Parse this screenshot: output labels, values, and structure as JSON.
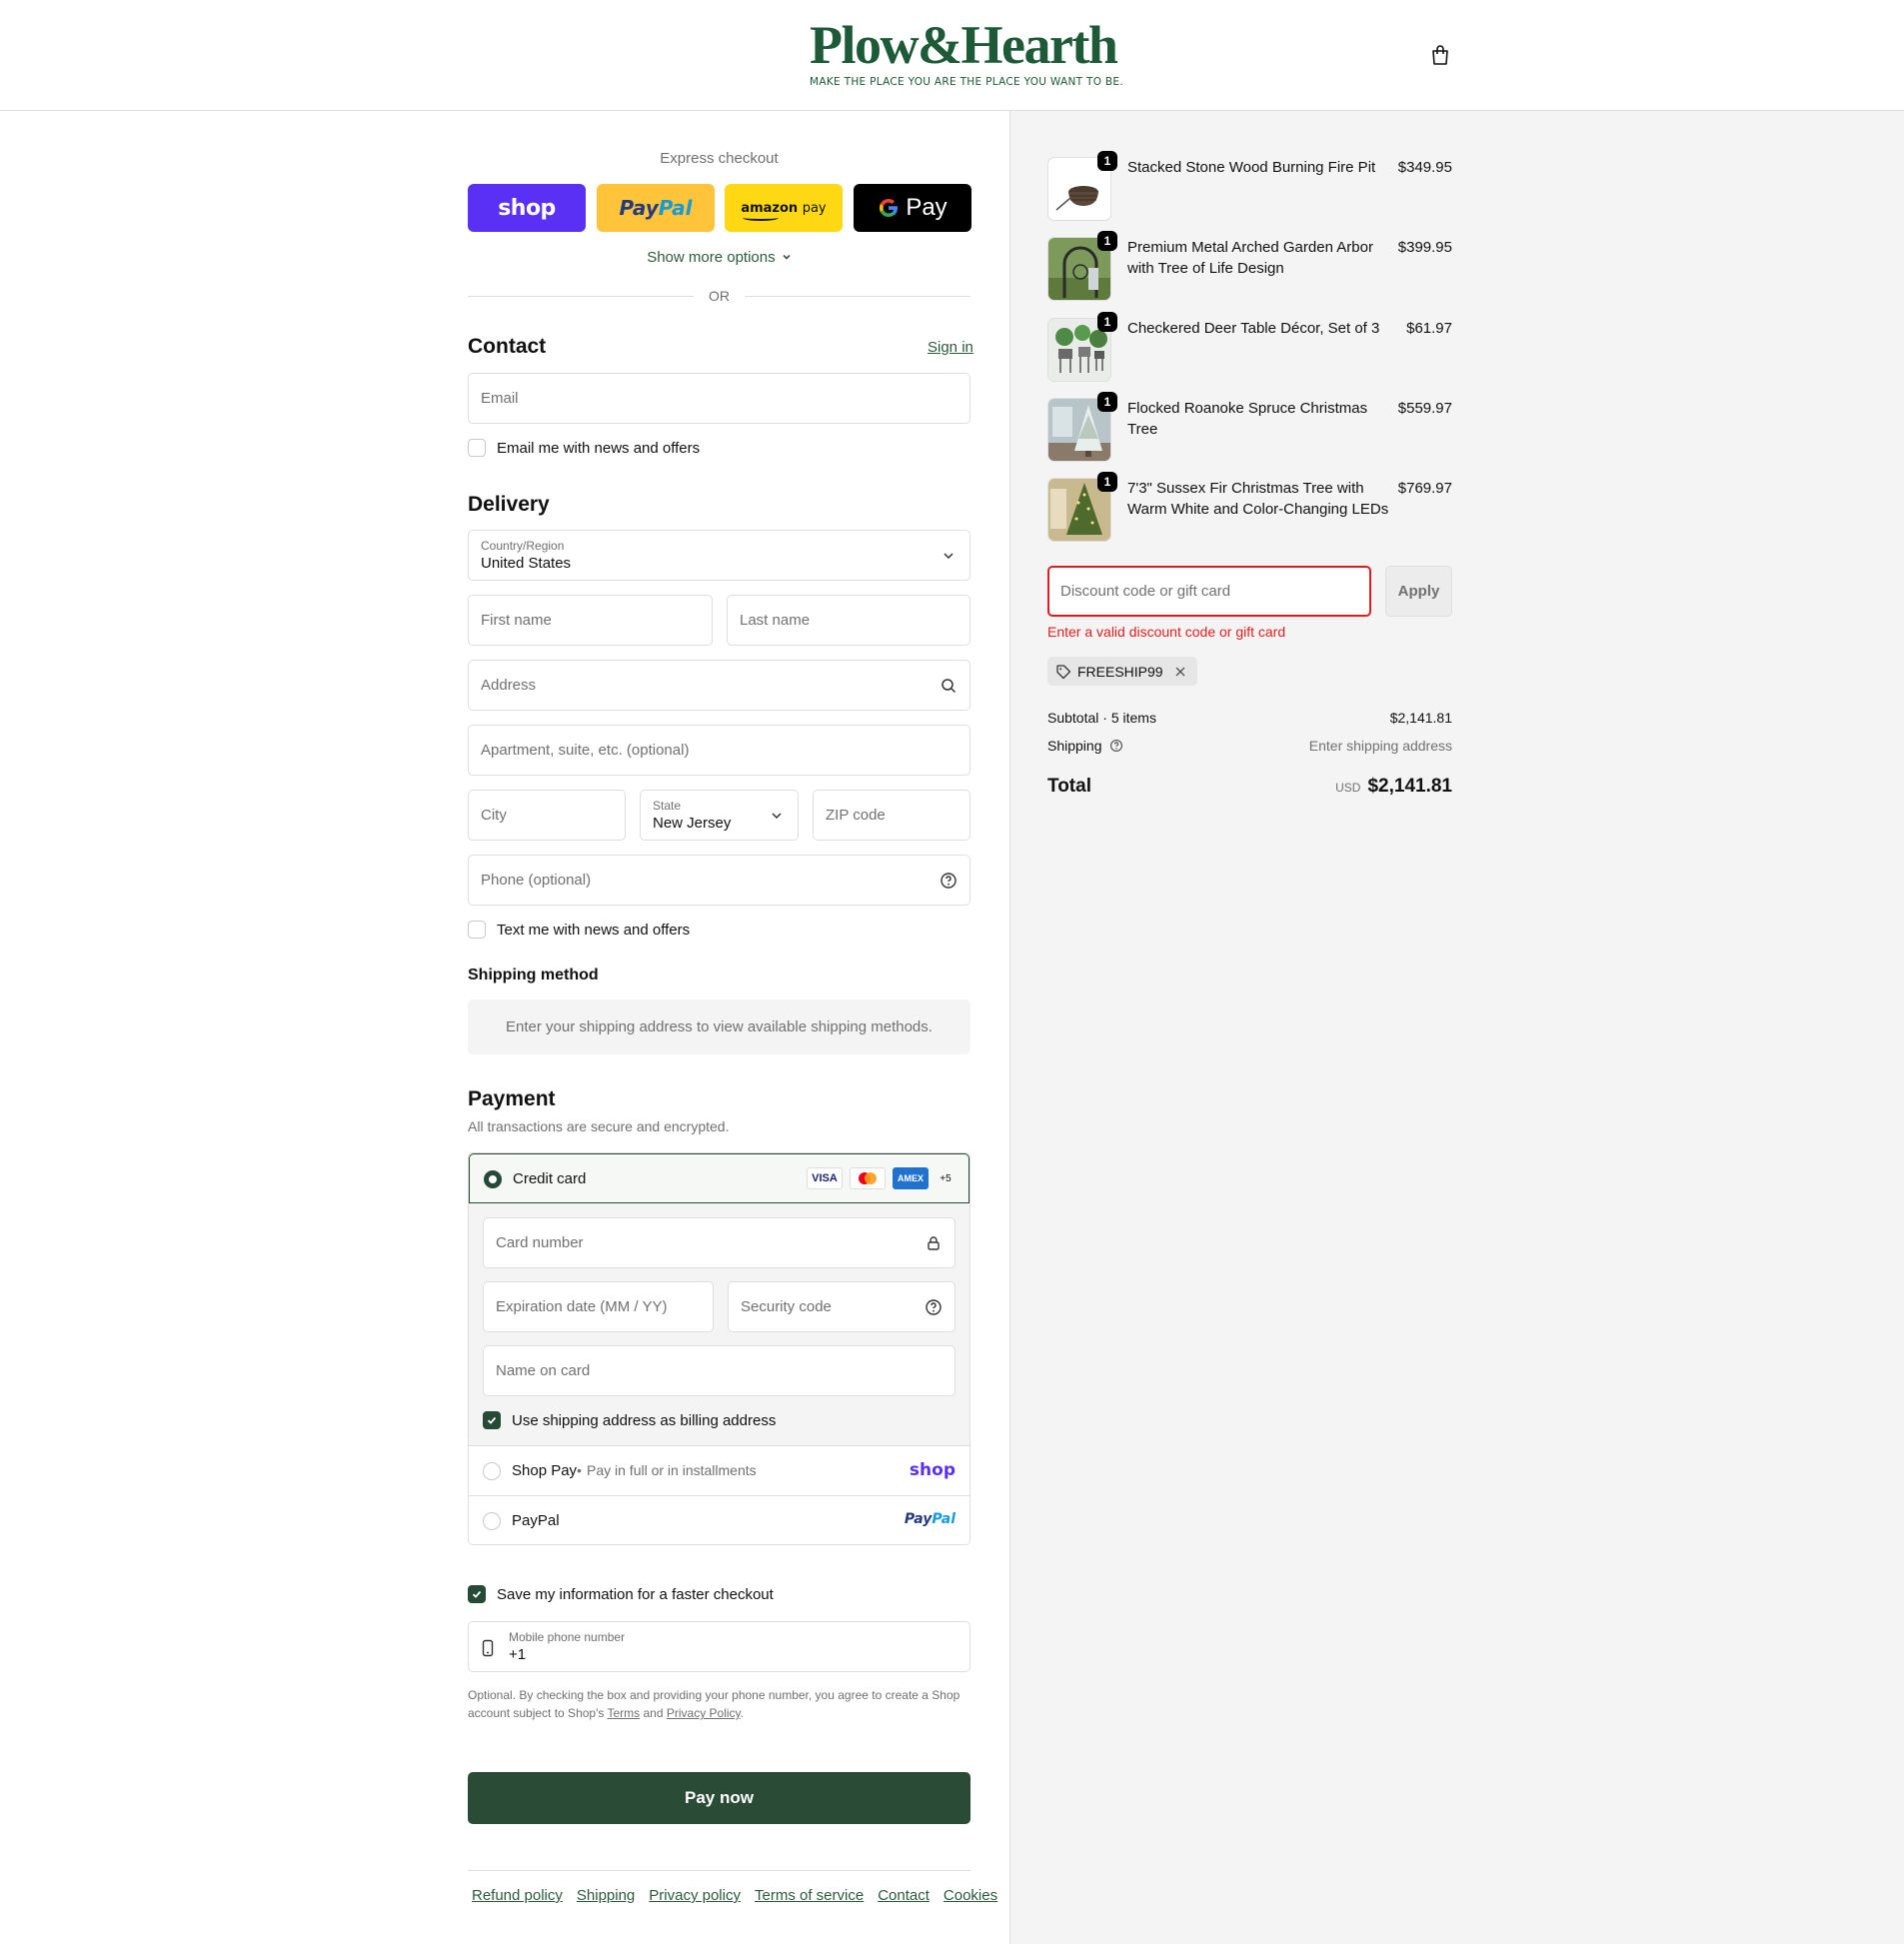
{
  "header": {
    "brand": "Plow&Hearth",
    "tagline": "MAKE THE PLACE YOU ARE THE PLACE YOU WANT TO BE."
  },
  "express": {
    "title": "Express checkout",
    "shop_label": "shop",
    "paypal_pay": "Pay",
    "paypal_pal": "Pal",
    "amazon_label": "amazon",
    "amazon_pay": "pay",
    "gpay_label": "Pay",
    "show_more": "Show more options",
    "or": "OR"
  },
  "contact": {
    "title": "Contact",
    "sign_in": "Sign in",
    "email_placeholder": "Email",
    "news_label": "Email me with news and offers"
  },
  "delivery": {
    "title": "Delivery",
    "country_label": "Country/Region",
    "country_value": "United States",
    "first_name": "First name",
    "last_name": "Last name",
    "address": "Address",
    "apartment": "Apartment, suite, etc. (optional)",
    "city": "City",
    "state_label": "State",
    "state_value": "New Jersey",
    "zip": "ZIP code",
    "phone": "Phone (optional)",
    "text_label": "Text me with news and offers"
  },
  "shipping_method": {
    "title": "Shipping method",
    "message": "Enter your shipping address to view available shipping methods."
  },
  "payment": {
    "title": "Payment",
    "subtitle": "All transactions are secure and encrypted.",
    "credit_card_label": "Credit card",
    "card_badges": [
      "VISA",
      "",
      "AMEX",
      "+5"
    ],
    "card_number": "Card number",
    "expiration": "Expiration date (MM / YY)",
    "security_code": "Security code",
    "name_on_card": "Name on card",
    "billing_same": "Use shipping address as billing address",
    "shoppay_label": "Shop Pay",
    "shoppay_sub": "Pay in full or in installments",
    "shoppay_logo": "shop",
    "paypal_label": "PayPal",
    "paypal_logo_pay": "Pay",
    "paypal_logo_pal": "Pal"
  },
  "save_info": {
    "label": "Save my information for a faster checkout",
    "phone_label": "Mobile phone number",
    "phone_value": "+1",
    "tos_1": "Optional. By checking the box and providing your phone number, you agree to create a Shop account subject to Shop's ",
    "terms": "Terms",
    "and": " and ",
    "privacy": "Privacy Policy",
    "period": "."
  },
  "pay_now": "Pay now",
  "footer_links": [
    "Refund policy",
    "Shipping",
    "Privacy policy",
    "Terms of service",
    "Contact",
    "Cookies"
  ],
  "cart": {
    "items": [
      {
        "qty": "1",
        "name": "Stacked Stone Wood Burning Fire Pit",
        "price": "$349.95",
        "thumb": "fire-pit"
      },
      {
        "qty": "1",
        "name": "Premium Metal Arched Garden Arbor with Tree of Life Design",
        "price": "$399.95",
        "thumb": "garden-arbor"
      },
      {
        "qty": "1",
        "name": "Checkered Deer Table Décor, Set of 3",
        "price": "$61.97",
        "thumb": "deer-decor"
      },
      {
        "qty": "1",
        "name": "Flocked Roanoke Spruce Christmas Tree",
        "price": "$559.97",
        "thumb": "flocked-tree"
      },
      {
        "qty": "1",
        "name": "7'3\" Sussex Fir Christmas Tree with Warm White and Color-Changing LEDs",
        "price": "$769.97",
        "thumb": "fir-tree"
      }
    ],
    "discount_placeholder": "Discount code or gift card",
    "apply": "Apply",
    "discount_error": "Enter a valid discount code or gift card",
    "applied_code": "FREESHIP99",
    "subtotal_label": "Subtotal · 5 items",
    "subtotal_value": "$2,141.81",
    "shipping_label": "Shipping",
    "shipping_value": "Enter shipping address",
    "total_label": "Total",
    "currency": "USD",
    "total_value": "$2,141.81"
  },
  "colors": {
    "brand_green": "#1d5a38",
    "button_green": "#2a4c36",
    "shop_purple": "#5a31f4",
    "error_red": "#dd1d1d"
  }
}
